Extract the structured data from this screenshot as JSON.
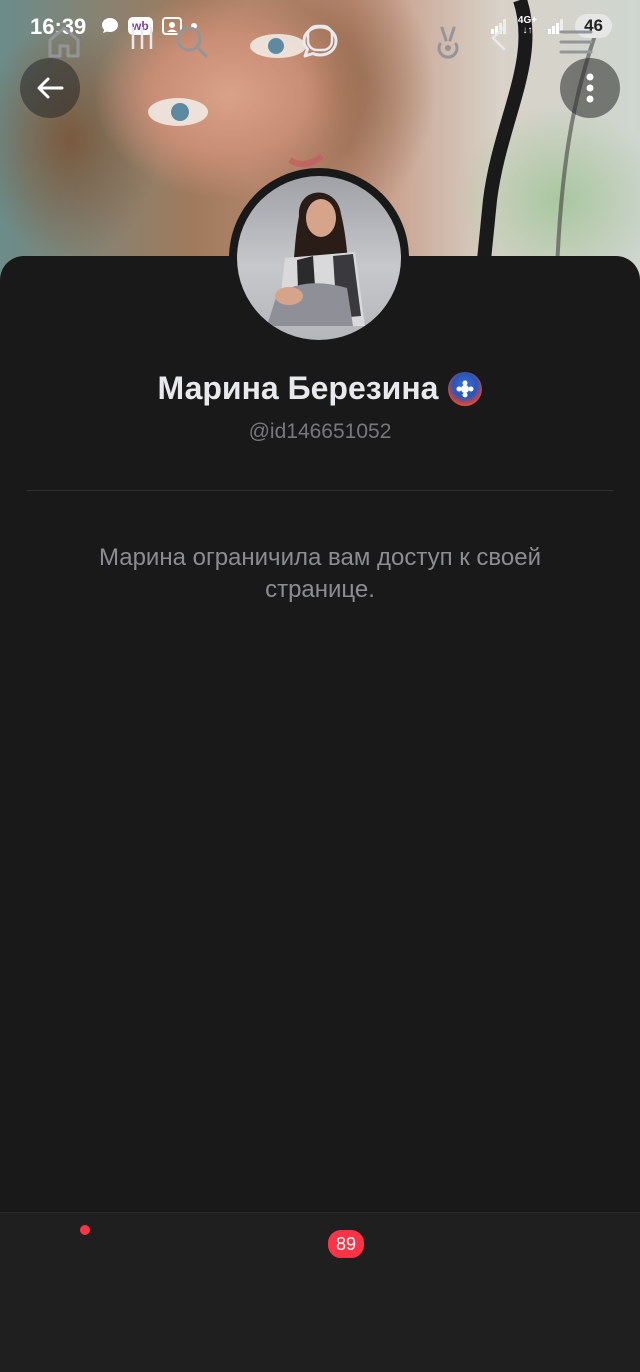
{
  "status_bar": {
    "time": "16:39",
    "wb_badge": "wb",
    "network": "4G+",
    "battery": "46",
    "icons": [
      "chat-bubble-icon",
      "wb-app-icon",
      "gallery-icon",
      "dot-icon",
      "signal-icon",
      "data-arrows-icon",
      "signal-icon"
    ]
  },
  "header": {
    "back_icon": "arrow-left-icon",
    "more_icon": "more-vertical-icon"
  },
  "profile": {
    "name": "Марина Березина",
    "handle": "@id146651052",
    "badge_icon": "profile-badge-icon",
    "restricted_message": "Марина ограничила вам доступ к своей странице."
  },
  "tab_bar": {
    "items": [
      {
        "name": "home",
        "icon": "home-icon",
        "has_dot": true
      },
      {
        "name": "search",
        "icon": "search-icon"
      },
      {
        "name": "messages",
        "icon": "chat-icon",
        "badge": "89"
      },
      {
        "name": "clips",
        "icon": "clips-icon"
      },
      {
        "name": "menu",
        "icon": "menu-icon"
      }
    ]
  },
  "system_nav": {
    "items": [
      "recents-icon",
      "home-circle-icon",
      "back-chevron-icon"
    ]
  },
  "colors": {
    "background": "#191919",
    "accent_red": "#ff3347",
    "text_primary": "#e8e9ec",
    "text_secondary": "#76787a"
  }
}
